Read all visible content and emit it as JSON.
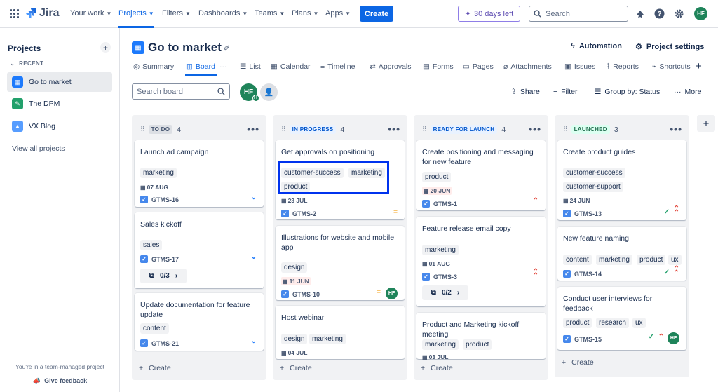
{
  "topnav": {
    "app_name": "Jira",
    "items": [
      {
        "label": "Your work",
        "active": false
      },
      {
        "label": "Projects",
        "active": true
      },
      {
        "label": "Filters",
        "active": false
      },
      {
        "label": "Dashboards",
        "active": false
      },
      {
        "label": "Teams",
        "active": false
      },
      {
        "label": "Plans",
        "active": false
      },
      {
        "label": "Apps",
        "active": false
      }
    ],
    "create_label": "Create",
    "trial_label": "30 days left",
    "search_placeholder": "Search",
    "user_initials": "HF"
  },
  "sidebar": {
    "title": "Projects",
    "recent_label": "RECENT",
    "projects": [
      {
        "name": "Go to market",
        "icon": "calendar-icon",
        "active": true
      },
      {
        "name": "The DPM",
        "icon": "notepad-icon",
        "active": false
      },
      {
        "name": "VX Blog",
        "icon": "mountain-icon",
        "active": false
      }
    ],
    "view_all": "View all projects",
    "footer_note": "You're in a team-managed project",
    "feedback": "Give feedback"
  },
  "project": {
    "title": "Go to market",
    "automation_label": "Automation",
    "settings_label": "Project settings"
  },
  "tabs": [
    {
      "label": "Summary",
      "icon": "globe-icon"
    },
    {
      "label": "Board",
      "icon": "board-icon",
      "active": true
    },
    {
      "label": "List",
      "icon": "list-icon"
    },
    {
      "label": "Calendar",
      "icon": "calendar-icon"
    },
    {
      "label": "Timeline",
      "icon": "timeline-icon"
    },
    {
      "label": "Approvals",
      "icon": "approvals-icon"
    },
    {
      "label": "Forms",
      "icon": "forms-icon"
    },
    {
      "label": "Pages",
      "icon": "pages-icon"
    },
    {
      "label": "Attachments",
      "icon": "attachment-icon"
    },
    {
      "label": "Issues",
      "icon": "issues-icon"
    },
    {
      "label": "Reports",
      "icon": "reports-icon"
    },
    {
      "label": "Shortcuts",
      "icon": "shortcuts-icon"
    }
  ],
  "toolbar": {
    "search_placeholder": "Search board",
    "avatar_initials": "HF",
    "avatar_sub": "H",
    "share_label": "Share",
    "filter_label": "Filter",
    "group_label": "Group by: Status",
    "more_label": "More"
  },
  "columns": [
    {
      "name": "TO DO",
      "count": "4",
      "cards": [
        {
          "title": "Launch ad campaign",
          "labels": [
            "marketing"
          ],
          "date": "07 AUG",
          "key": "GTMS-16",
          "priority": "low"
        },
        {
          "title": "Sales kickoff",
          "labels": [
            "sales"
          ],
          "key": "GTMS-17",
          "priority": "low",
          "subtasks": "0/3"
        },
        {
          "title": "Update documentation for feature update",
          "labels": [
            "content"
          ],
          "key": "GTMS-21",
          "priority": "low"
        }
      ],
      "create_label": "Create"
    },
    {
      "name": "IN PROGRESS",
      "count": "4",
      "cards": [
        {
          "title": "Get approvals on positioning",
          "labels": [
            "customer-success",
            "marketing",
            "product"
          ],
          "date": "23 JUL",
          "key": "GTMS-2",
          "priority": "medium"
        },
        {
          "title": "Illustrations for website and mobile app",
          "labels": [
            "design"
          ],
          "date": "11 JUN",
          "date_overdue": true,
          "key": "GTMS-10",
          "priority": "medium",
          "assignee": "HF"
        },
        {
          "title": "Host webinar",
          "labels": [
            "design",
            "marketing"
          ],
          "date": "04 JUL"
        }
      ],
      "create_label": "Create"
    },
    {
      "name": "READY FOR LAUNCH",
      "count": "4",
      "cards": [
        {
          "title": "Create positioning and messaging for new feature",
          "labels": [
            "product"
          ],
          "date": "20 JUN",
          "date_overdue": true,
          "key": "GTMS-1",
          "priority": "high"
        },
        {
          "title": "Feature release email copy",
          "labels": [
            "marketing"
          ],
          "date": "01 AUG",
          "key": "GTMS-3",
          "priority": "highest",
          "subtasks": "0/2"
        },
        {
          "title": "Product and Marketing kickoff meeting",
          "labels": [
            "marketing",
            "product"
          ],
          "date": "03 JUL"
        }
      ],
      "create_label": "Create"
    },
    {
      "name": "LAUNCHED",
      "count": "3",
      "cards": [
        {
          "title": "Create product guides",
          "labels": [
            "customer-success",
            "customer-support"
          ],
          "date": "24 JUN",
          "key": "GTMS-13",
          "priority": "highest",
          "done": true
        },
        {
          "title": "New feature naming",
          "labels": [
            "content",
            "marketing",
            "product",
            "ux"
          ],
          "key": "GTMS-14",
          "priority": "highest",
          "done": true
        },
        {
          "title": "Conduct user interviews for feedback",
          "labels": [
            "product",
            "research",
            "ux"
          ],
          "key": "GTMS-15",
          "priority": "high",
          "done": true,
          "assignee": "HF"
        }
      ],
      "create_label": "Create"
    }
  ],
  "colors": {
    "accent": "#0c66e4",
    "todo_lozenge_bg": "#dcdfe4",
    "inprogress_lozenge_bg": "#e9f2ff",
    "ready_lozenge_bg": "#e9f2ff",
    "launched_lozenge_bg": "#dcfff1",
    "highlight_box": "#0033ee"
  }
}
